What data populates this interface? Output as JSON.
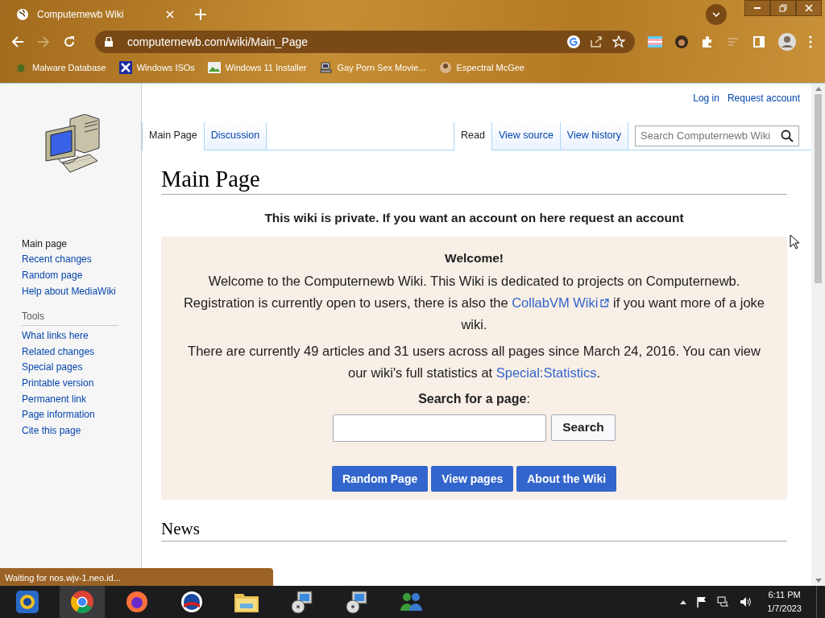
{
  "browser": {
    "tab_title": "Computernewb Wiki",
    "address": "computernewb.com/wiki/Main_Page",
    "bookmarks": [
      {
        "label": "Malware Database",
        "kind": "bug"
      },
      {
        "label": "Windows ISOs",
        "kind": "x"
      },
      {
        "label": "Windows 11 Installer",
        "kind": "image"
      },
      {
        "label": "Gay Porn Sex Movie...",
        "kind": "pc"
      },
      {
        "label": "Espectral McGee",
        "kind": "face"
      }
    ],
    "status_text": "Waiting for nos.wjv-1.neo.id..."
  },
  "wiki": {
    "personal_links": [
      "Log in",
      "Request account"
    ],
    "namespace_tabs": [
      {
        "label": "Main Page",
        "selected": true
      },
      {
        "label": "Discussion",
        "selected": false
      }
    ],
    "view_tabs": [
      {
        "label": "Read",
        "selected": true
      },
      {
        "label": "View source",
        "selected": false
      },
      {
        "label": "View history",
        "selected": false
      }
    ],
    "search": {
      "placeholder": "Search Computernewb Wiki"
    },
    "navigation": [
      {
        "label": "Main page",
        "selected": true
      },
      {
        "label": "Recent changes",
        "selected": false
      },
      {
        "label": "Random page",
        "selected": false
      },
      {
        "label": "Help about MediaWiki",
        "selected": false
      }
    ],
    "tools": {
      "heading": "Tools",
      "items": [
        "What links here",
        "Related changes",
        "Special pages",
        "Printable version",
        "Permanent link",
        "Page information",
        "Cite this page"
      ]
    },
    "title": "Main Page",
    "notice": "This wiki is private. If you want an account on here request an account",
    "welcome": {
      "heading": "Welcome!",
      "paragraphs": [
        {
          "before": "Welcome to the Computernewb Wiki. This Wiki is dedicated to projects on Computernewb. Registration is currently open to users, there is also the ",
          "link": "CollabVM Wiki",
          "external": true,
          "after": " if you want more of a joke wiki."
        },
        {
          "before": "There are currently 49 articles and 31 users across all pages since March 24, 2016. You can view our wiki's full statistics at ",
          "link": "Special:Statistics",
          "external": false,
          "after": "."
        }
      ],
      "search_label": "**Search for a page**:",
      "search_button": "Search",
      "buttons": [
        "Random Page",
        "View pages",
        "About the Wiki"
      ]
    },
    "news_heading": "News"
  },
  "taskbar": {
    "apps": [
      {
        "kind": "start",
        "selected": false
      },
      {
        "kind": "chrome",
        "selected": true
      },
      {
        "kind": "firefox",
        "selected": false
      },
      {
        "kind": "globe",
        "selected": false
      },
      {
        "kind": "folder",
        "selected": false
      },
      {
        "kind": "installer",
        "selected": false
      },
      {
        "kind": "installer",
        "selected": false
      },
      {
        "kind": "people",
        "selected": false
      }
    ],
    "time": "6:11 PM",
    "date": "1/7/2023"
  }
}
